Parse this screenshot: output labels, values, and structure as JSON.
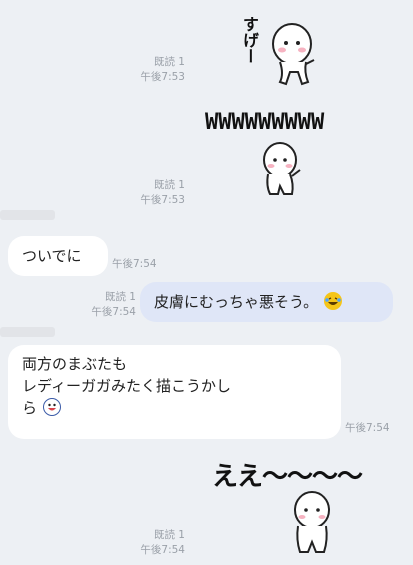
{
  "colors": {
    "background": "#edf0f4",
    "incoming_bubble": "#ffffff",
    "outgoing_bubble": "#dfe6f7",
    "meta_text": "#9aa0a8"
  },
  "messages": [
    {
      "id": "m1",
      "type": "sticker",
      "side": "right",
      "text": "すげー",
      "read": "既読 1",
      "time": "午後7:53",
      "icon": "blob-character-sticker"
    },
    {
      "id": "m2",
      "type": "sticker",
      "side": "right",
      "text": "WWWWWWWWW",
      "read": "既読 1",
      "time": "午後7:53",
      "icon": "blob-character-sticker"
    },
    {
      "id": "m3",
      "type": "text",
      "side": "left",
      "text": "ついでに",
      "time": "午後7:54"
    },
    {
      "id": "m4",
      "type": "text",
      "side": "right",
      "text": "皮膚にむっちゃ悪そう。",
      "read": "既読 1",
      "time": "午後7:54",
      "emoji": "laughing-tears-emoji"
    },
    {
      "id": "m5",
      "type": "text",
      "side": "left",
      "lines": [
        "両方のまぶたも",
        "レディーガガみたく描こうかし",
        "ら"
      ],
      "time": "午後7:54",
      "emoji": "grinning-face-emoji"
    },
    {
      "id": "m6",
      "type": "sticker",
      "side": "right",
      "text": "ええ〜〜〜〜",
      "read": "既読 1",
      "time": "午後7:54",
      "icon": "blob-character-sticker"
    }
  ]
}
